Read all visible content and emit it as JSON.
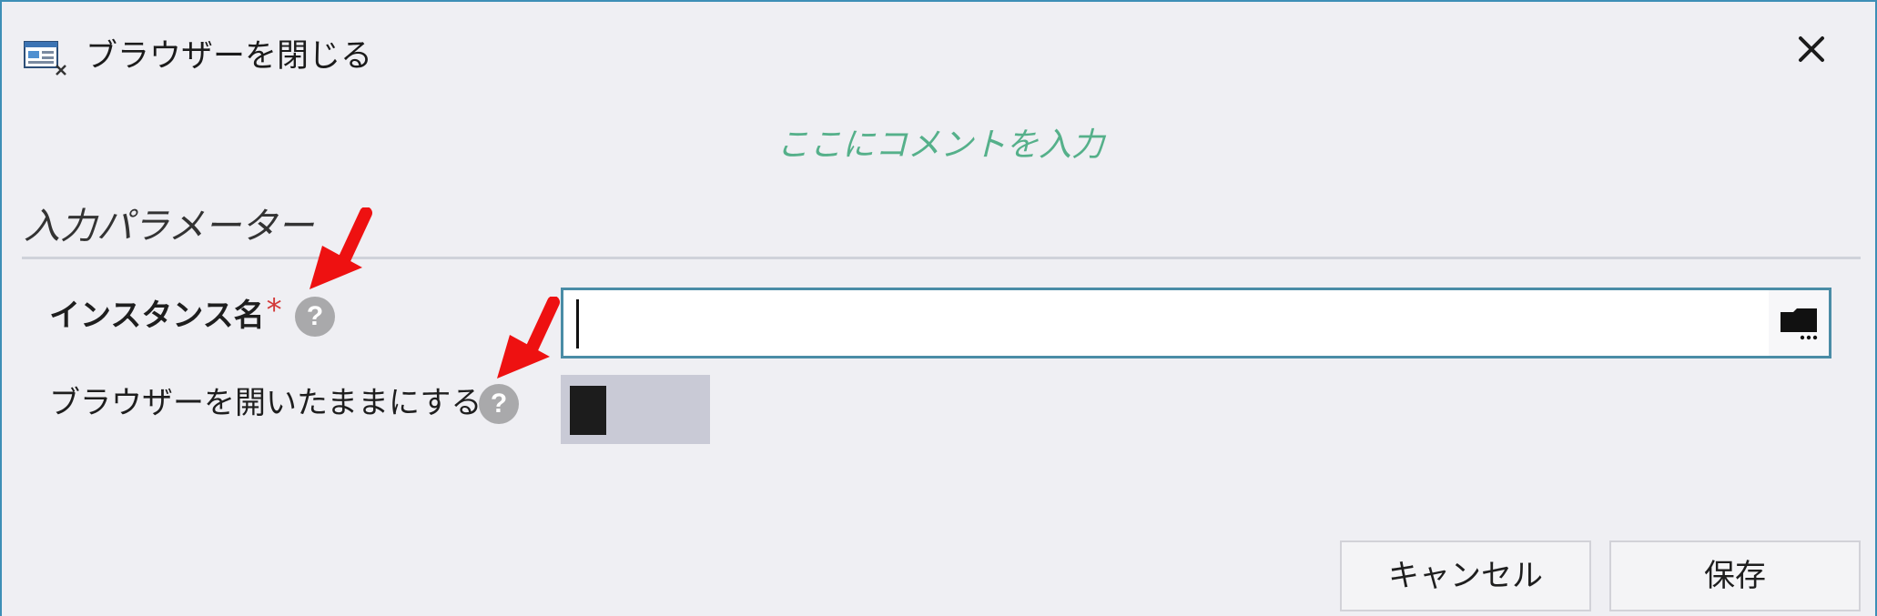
{
  "dialog": {
    "title": "ブラウザーを閉じる",
    "close_glyph": "✕"
  },
  "comment": "ここにコメントを入力",
  "section": {
    "title": "入力パラメーター"
  },
  "fields": {
    "instance_name": {
      "label": "インスタンス名",
      "required_mark": "*",
      "help_glyph": "?",
      "value": ""
    },
    "keep_browser_open": {
      "label": "ブラウザーを開いたままにする",
      "help_glyph": "?",
      "enabled": false
    }
  },
  "buttons": {
    "cancel": "キャンセル",
    "save": "保存"
  },
  "icons": {
    "title": "browser-close-icon",
    "close": "close-icon",
    "help": "help-icon",
    "variable": "variable-picker-icon",
    "annotation": "annotation-arrow-icon"
  },
  "colors": {
    "dialog_border": "#3d8fb6",
    "dialog_background": "#efeff3",
    "comment_text": "#55b08a",
    "required_mark": "#d33a3a",
    "annotation_arrow": "#ee1111",
    "toggle_track": "#c9cad6"
  }
}
